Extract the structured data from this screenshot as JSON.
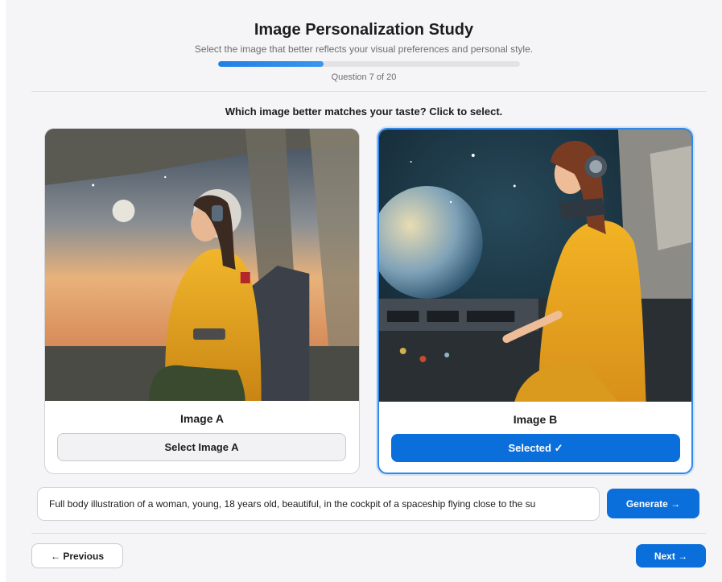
{
  "header": {
    "title": "Image Personalization Study",
    "subtitle": "Select the image that better reflects your visual preferences and personal style.",
    "progress_text": "Question 7 of 20",
    "progress_fraction": 0.35
  },
  "question": "Which image better matches your taste? Click to select.",
  "options": [
    {
      "label": "Image A",
      "button_label": "Select Image A",
      "selected": false,
      "image": "watercolor-astronaut-woman-cockpit-illustration"
    },
    {
      "label": "Image B",
      "button_label": "Selected ✓",
      "selected": true,
      "image": "painted-astronaut-woman-spaceship-planet-illustration"
    }
  ],
  "prompt": {
    "value": "Full body illustration of a woman, young, 18 years old, beautiful, in the cockpit of a spaceship flying close to the su"
  },
  "buttons": {
    "generate": "Generate →",
    "previous": "← Previous",
    "next": "Next →"
  },
  "colors": {
    "accent": "#0a6fdb",
    "selected_border": "#2f88ea",
    "background": "#f5f5f7"
  }
}
